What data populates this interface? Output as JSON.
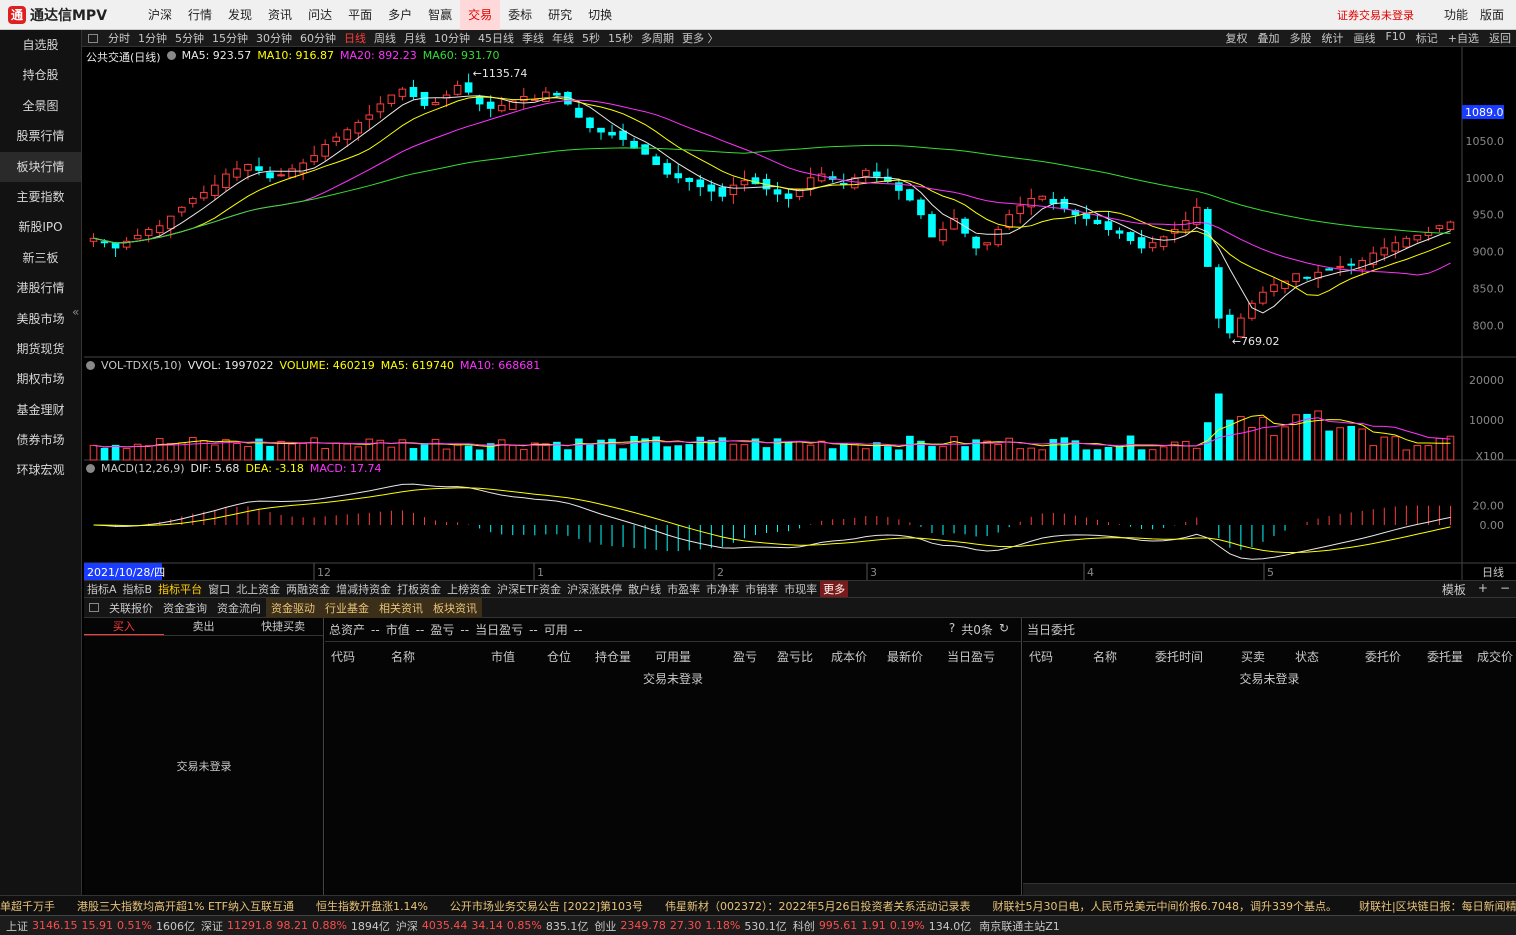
{
  "app": {
    "title": "通达信MPV",
    "logo_char": "通"
  },
  "top_menu": [
    "沪深",
    "行情",
    "发现",
    "资讯",
    "问达",
    "平面",
    "多户",
    "智赢",
    "交易",
    "委标",
    "研究",
    "切换"
  ],
  "top_menu_active": "交易",
  "top_right": {
    "login_notice": "证券交易未登录",
    "func": "功能",
    "layout": "版面"
  },
  "sidebar": [
    "自选股",
    "持仓股",
    "全景图",
    "股票行情",
    "板块行情",
    "主要指数",
    "新股IPO",
    "新三板",
    "港股行情",
    "美股市场",
    "期货现货",
    "期权市场",
    "基金理财",
    "债券市场",
    "环球宏观"
  ],
  "sidebar_active": "板块行情",
  "period_bar": [
    "分时",
    "1分钟",
    "5分钟",
    "15分钟",
    "30分钟",
    "60分钟",
    "日线",
    "周线",
    "月线",
    "10分钟",
    "45日线",
    "季线",
    "年线",
    "5秒",
    "15秒",
    "多周期",
    "更多 〉"
  ],
  "period_active": "日线",
  "period_right": [
    "复权",
    "叠加",
    "多股",
    "统计",
    "画线",
    "F10",
    "标记",
    "+自选",
    "返回"
  ],
  "chart_data": {
    "type": "candlestick",
    "title": "公共交通(日线)",
    "ma_legend": [
      {
        "name": "MA5",
        "value": "923.57",
        "color": "#e8e8e8"
      },
      {
        "name": "MA10",
        "value": "916.87",
        "color": "#ffff00"
      },
      {
        "name": "MA20",
        "value": "892.23",
        "color": "#ff33ff"
      },
      {
        "name": "MA60",
        "value": "931.70",
        "color": "#33dd33"
      }
    ],
    "y_ticks": [
      800,
      850,
      900,
      950,
      1000,
      1050
    ],
    "current_price_label": "1089.0",
    "high_label": "1135.74",
    "low_label": "769.02",
    "ylim": [
      760,
      1150
    ],
    "x_ticks": [
      "12",
      "1",
      "2",
      "3",
      "4",
      "5"
    ],
    "start_date": "2021/10/28/四",
    "closes": [
      918,
      912,
      905,
      914,
      922,
      930,
      935,
      948,
      960,
      972,
      980,
      990,
      1005,
      1012,
      1018,
      1010,
      1000,
      1004,
      1012,
      1020,
      1030,
      1045,
      1055,
      1065,
      1075,
      1085,
      1100,
      1112,
      1120,
      1110,
      1098,
      1102,
      1112,
      1125,
      1116,
      1100,
      1094,
      1098,
      1104,
      1110,
      1106,
      1116,
      1112,
      1100,
      1082,
      1068,
      1062,
      1058,
      1052,
      1040,
      1032,
      1018,
      1005,
      1000,
      995,
      988,
      982,
      975,
      990,
      996,
      992,
      985,
      978,
      972,
      985,
      1000,
      1005,
      998,
      992,
      1000,
      1010,
      1002,
      995,
      983,
      970,
      950,
      920,
      930,
      945,
      925,
      905,
      912,
      930,
      950,
      962,
      972,
      975,
      965,
      958,
      950,
      945,
      938,
      930,
      925,
      915,
      905,
      912,
      920,
      930,
      942,
      960,
      880,
      810,
      790,
      810,
      830,
      845,
      855,
      860,
      870,
      865,
      872,
      875,
      880,
      882,
      888,
      898,
      905,
      912,
      918,
      922,
      926,
      935,
      940
    ]
  },
  "volume_legend": {
    "prefix": "VOL-TDX(5,10)",
    "items": [
      {
        "name": "VVOL",
        "value": "1997022",
        "color": "#e8e8e8"
      },
      {
        "name": "VOLUME",
        "value": "460219",
        "color": "#ffff00"
      },
      {
        "name": "MA5",
        "value": "619740",
        "color": "#ffff00"
      },
      {
        "name": "MA10",
        "value": "668681",
        "color": "#ff33ff"
      }
    ],
    "y_ticks": [
      "20000",
      "10000",
      "X100"
    ]
  },
  "macd_legend": {
    "prefix": "MACD(12,26,9)",
    "items": [
      {
        "name": "DIF",
        "value": "5.68",
        "color": "#e8e8e8"
      },
      {
        "name": "DEA",
        "value": "-3.18",
        "color": "#ffff00"
      },
      {
        "name": "MACD",
        "value": "17.74",
        "color": "#ff33ff"
      }
    ],
    "y_ticks": [
      "20.00",
      "0.00"
    ]
  },
  "x_axis_right": "日线",
  "indicator_tabs": [
    "指标A",
    "指标B",
    "指标平台",
    "窗口",
    "北上资金",
    "两融资金",
    "增减持资金",
    "打板资金",
    "上榜资金",
    "沪深ETF资金",
    "沪深涨跌停",
    "散户线",
    "市盈率",
    "市净率",
    "市销率",
    "市现率",
    "更多"
  ],
  "indicator_active": "指标平台",
  "indicator_right": [
    "模板",
    "+",
    "−"
  ],
  "panel_tabs": [
    "关联报价",
    "资金查询",
    "资金流向",
    "资金驱动",
    "行业基金",
    "相关资讯",
    "板块资讯"
  ],
  "panel_active": "资金驱动",
  "trade": {
    "tabs": [
      "买入",
      "卖出",
      "快捷买卖"
    ],
    "not_logged": "交易未登录"
  },
  "positions": {
    "summary": [
      "总资产",
      "--",
      "市值",
      "--",
      "盈亏",
      "--",
      "当日盈亏",
      "--",
      "可用",
      "--"
    ],
    "help": "?",
    "count": "共0条",
    "columns": [
      "代码",
      "名称",
      "市值",
      "仓位",
      "持仓量",
      "可用量",
      "盈亏",
      "盈亏比",
      "成本价",
      "最新价",
      "当日盈亏"
    ],
    "empty": "交易未登录"
  },
  "orders": {
    "title": "当日委托",
    "columns": [
      "代码",
      "名称",
      "委托时间",
      "买卖",
      "状态",
      "委托价",
      "委托量",
      "成交价"
    ],
    "empty": "交易未登录"
  },
  "news": [
    "单超千万手",
    "港股三大指数均高开超1% ETF纳入互联互通",
    "恒生指数开盘涨1.14%",
    "公开市场业务交易公告 [2022]第103号",
    "伟星新材（002372）：2022年5月26日投资者关系活动记录表",
    "财联社5月30日电，人民币兑美元中间价报6.7048，调升339个基点。",
    "财联社|区块链日报：每日新闻精选"
  ],
  "status": {
    "sh": {
      "label": "上证",
      "value": "3146.15",
      "chg": "15.91",
      "pct": "0.51%",
      "amt": "1606亿"
    },
    "sz": {
      "label": "深证",
      "value": "11291.8",
      "chg": "98.21",
      "pct": "0.88%",
      "amt": "1894亿"
    },
    "hs": {
      "label": "沪深",
      "value": "4035.44",
      "chg": "34.14",
      "pct": "0.85%",
      "amt": "835.1亿"
    },
    "cy": {
      "label": "创业",
      "value": "2349.78",
      "chg": "27.30",
      "pct": "1.18%",
      "amt": "530.1亿"
    },
    "kc": {
      "label": "科创",
      "value": "995.61",
      "chg": "1.91",
      "pct": "0.19%",
      "amt": "134.0亿"
    },
    "server": "南京联通主站Z1"
  },
  "colors": {
    "up": "#ff3c3c",
    "down": "#00ffff",
    "ma5": "#e8e8e8",
    "ma10": "#ffff00",
    "ma20": "#ff33ff",
    "ma60": "#33dd33",
    "accent": "#e00000"
  }
}
